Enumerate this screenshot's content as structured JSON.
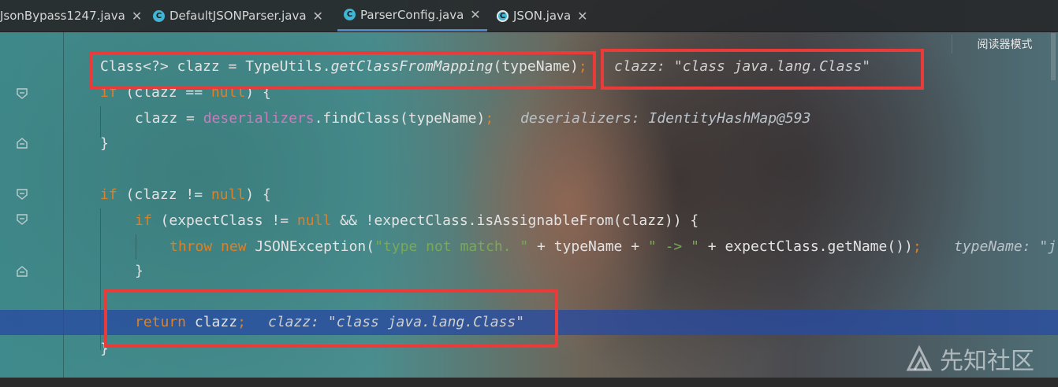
{
  "tabs": [
    {
      "label": "JsonBypass1247.java",
      "icon": "none",
      "active": false
    },
    {
      "label": "DefaultJSONParser.java",
      "icon": "class-icon",
      "active": false
    },
    {
      "label": "ParserConfig.java",
      "icon": "class-icon",
      "active": true
    },
    {
      "label": "JSON.java",
      "icon": "class-locked-icon",
      "active": false
    }
  ],
  "tab_close": "✕",
  "class_icon_glyph": "C",
  "reader_mode": "阅读器模式",
  "code": {
    "l1": {
      "a": "Class<?> clazz = TypeUtils.",
      "b": "getClassFromMapping",
      "c": "(typeName)",
      "d": ";",
      "hint": "clazz: \"class java.lang.Class\""
    },
    "l2": {
      "a": "if",
      "b": " (clazz == ",
      "c": "null",
      "d": ") {"
    },
    "l3": {
      "a": "clazz = ",
      "b": "deserializers",
      "c": ".findClass(typeName)",
      "d": ";",
      "hint": "deserializers: IdentityHashMap@593"
    },
    "l4": {
      "a": "}"
    },
    "l6": {
      "a": "if",
      "b": " (clazz != ",
      "c": "null",
      "d": ") {"
    },
    "l7": {
      "a": "if",
      "b": " (expectClass != ",
      "c": "null",
      "d": " && !expectClass.isAssignableFrom(clazz)) {"
    },
    "l8": {
      "a": "throw new",
      "b": " JSONException(",
      "c": "\"type not match. \"",
      "d": " + typeName + ",
      "e": "\" -> \"",
      "f": " + expectClass.getName())",
      "g": ";",
      "hint": "typeName: \"j"
    },
    "l9": {
      "a": "}"
    },
    "l11": {
      "a": "return",
      "b": " clazz",
      "c": ";",
      "hint": "clazz: \"class java.lang.Class\""
    },
    "l12": {
      "a": "}"
    }
  },
  "watermark": {
    "text": "先知社区",
    "logo": "xianzhi-logo"
  },
  "colors": {
    "highlight": "#2b4ba0",
    "annotation_box": "#ea3b3b",
    "keyword": "#d9822b",
    "member": "#c77dbb",
    "string": "#7aa85a"
  }
}
